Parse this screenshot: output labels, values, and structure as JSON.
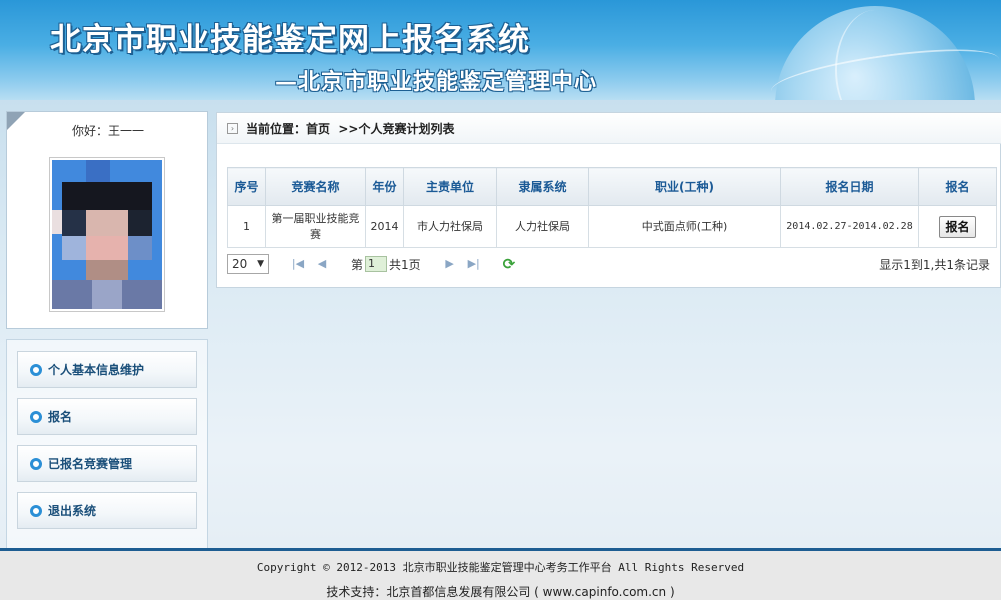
{
  "header": {
    "title": "北京市职业技能鉴定网上报名系统",
    "subtitle": "—北京市职业技能鉴定管理中心"
  },
  "user": {
    "greeting": "你好：王一一"
  },
  "sidebar": {
    "items": [
      {
        "label": "个人基本信息维护"
      },
      {
        "label": "报名"
      },
      {
        "label": "已报名竞赛管理"
      },
      {
        "label": "退出系统"
      }
    ]
  },
  "breadcrumb": {
    "text": "当前位置：首页  >>个人竞赛计划列表"
  },
  "table": {
    "columns": [
      "序号",
      "竞赛名称",
      "年份",
      "主责单位",
      "隶属系统",
      "职业(工种)",
      "报名日期",
      "报名"
    ],
    "rows": [
      {
        "index": "1",
        "name": "第一届职业技能竞赛",
        "year": "2014",
        "unit": "市人力社保局",
        "system": "人力社保局",
        "occupation": "中式面点师(工种)",
        "date": "2014.02.27-2014.02.28",
        "action": "报名"
      }
    ]
  },
  "pager": {
    "page_size": "20",
    "page_prefix": "第",
    "page_value": "1",
    "page_suffix": "共1页",
    "summary": "显示1到1,共1条记录"
  },
  "footer": {
    "copyright": "Copyright © 2012-2013 北京市职业技能鉴定管理中心考务工作平台 All Rights Reserved",
    "support": "技术支持：北京首都信息发展有限公司 ( www.capinfo.com.cn )"
  },
  "colors": {
    "header_blue": "#2a97d8",
    "link_blue": "#1b5a96",
    "footer_rule": "#1d5d92"
  }
}
